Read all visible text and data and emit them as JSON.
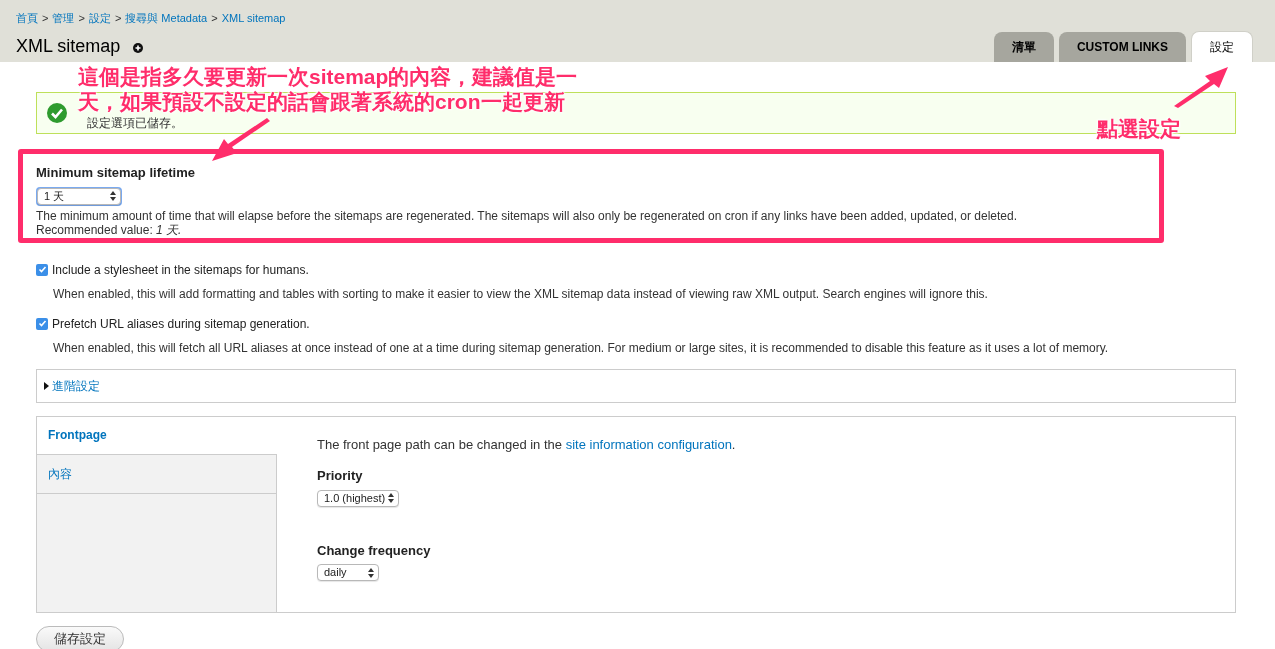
{
  "breadcrumb": [
    "首頁",
    "管理",
    "設定",
    "搜尋與 Metadata",
    "XML sitemap"
  ],
  "breadcrumb_separator": ">",
  "title": "XML sitemap",
  "tabs": [
    {
      "label": "清單",
      "selected": false
    },
    {
      "label": "CUSTOM LINKS",
      "selected": false
    },
    {
      "label": "設定",
      "selected": true
    }
  ],
  "status_message": "設定選項已儲存。",
  "lifetime": {
    "label": "Minimum sitemap lifetime",
    "value": "1 天",
    "description": "The minimum amount of time that will elapse before the sitemaps are regenerated. The sitemaps will also only be regenerated on cron if any links have been added, updated, or deleted.",
    "recommended_label": "Recommended value:",
    "recommended_value": "1 天."
  },
  "checkboxes": [
    {
      "label": "Include a stylesheet in the sitemaps for humans.",
      "checked": true,
      "description": "When enabled, this will add formatting and tables with sorting to make it easier to view the XML sitemap data instead of viewing raw XML output. Search engines will ignore this."
    },
    {
      "label": "Prefetch URL aliases during sitemap generation.",
      "checked": true,
      "description": "When enabled, this will fetch all URL aliases at once instead of one at a time during sitemap generation. For medium or large sites, it is recommended to disable this feature as it uses a lot of memory."
    }
  ],
  "advanced": {
    "label": "進階設定",
    "expanded": false
  },
  "vertical_tabs": [
    {
      "label": "Frontpage",
      "selected": true
    },
    {
      "label": "內容",
      "selected": false
    }
  ],
  "pane": {
    "intro": "The front page path can be changed in the",
    "link": "site information configuration",
    "intro_end": ".",
    "priority_label": "Priority",
    "priority_value": "1.0 (highest)",
    "frequency_label": "Change frequency",
    "frequency_value": "daily"
  },
  "save_button": "儲存設定",
  "annotations": {
    "callout_lines": [
      "這個是指多久要更新一次sitemap的內容，建議值是一",
      "天，如果預設不設定的話會跟著系統的cron一起更新"
    ],
    "tab_callout": "點選設定"
  }
}
